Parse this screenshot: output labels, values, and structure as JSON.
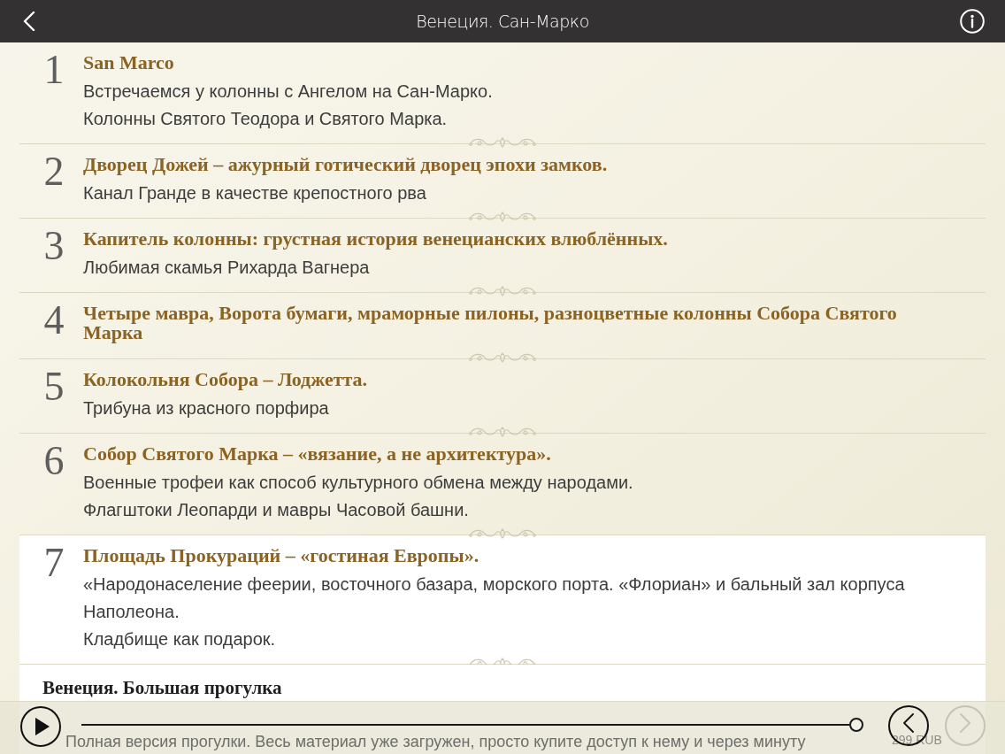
{
  "header": {
    "title": "Венеция. Сан-Марко"
  },
  "stops": [
    {
      "number": "1",
      "title": "San Marco",
      "lines": [
        "Встречаемся у колонны с Ангелом на Сан-Марко.",
        "Колонны Святого Теодора и Святого Марка."
      ],
      "selected": false
    },
    {
      "number": "2",
      "title": "Дворец Дожей – ажурный готический дворец эпохи замков.",
      "lines": [
        "Канал Гранде в качестве крепостного рва"
      ],
      "selected": false
    },
    {
      "number": "3",
      "title": "Капитель колонны: грустная история венецианских влюблённых.",
      "lines": [
        "Любимая скамья Рихарда Вагнера"
      ],
      "selected": false
    },
    {
      "number": "4",
      "title": "Четыре мавра, Ворота бумаги, мраморные пилоны, разноцветные колонны Собора Святого Марка",
      "selected": false
    },
    {
      "number": "5",
      "title": "Колокольня Собора – Лоджетта.",
      "lines": [
        "Трибуна из красного порфира"
      ],
      "selected": false
    },
    {
      "number": "6",
      "title": "Собор Святого Марка – «вязание, а не архитектура».",
      "lines": [
        "Военные трофеи как способ культурного обмена между народами.",
        "Флагштоки Леопарди и мавры Часовой башни."
      ],
      "selected": false
    },
    {
      "number": "7",
      "title": "Площадь Прокураций – «гостиная Европы».",
      "lines": [
        "«Народонаселение феерии, восточного базара, морского порта. «Флориан» и бальный зал корпуса Наполеона.",
        "Кладбище как подарок."
      ],
      "selected": true
    }
  ],
  "product": {
    "title": "Венеция. Большая прогулка",
    "description": "Полная версия прогулки. Весь материал уже загружен, просто купите доступ к нему и через минуту",
    "price": "299 RUB"
  },
  "player": {
    "level": 1,
    "buttons": [
      {
        "kind": "previous",
        "disabled": false
      },
      {
        "kind": "next",
        "disabled": true
      }
    ]
  }
}
